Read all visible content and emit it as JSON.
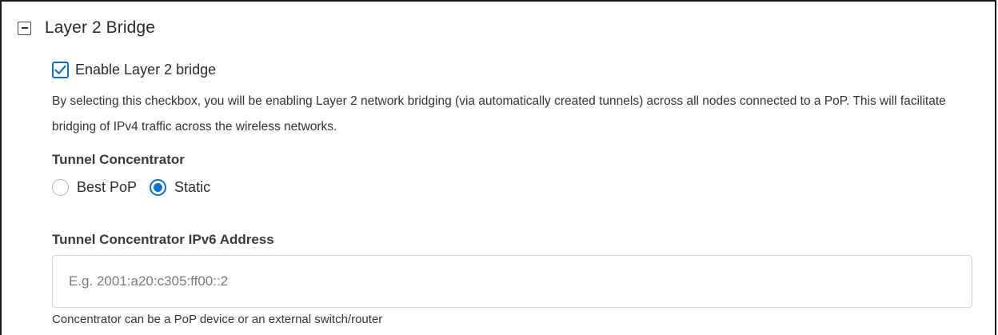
{
  "section": {
    "title": "Layer 2 Bridge",
    "toggle_icon": "collapse-minus-icon"
  },
  "enable_bridge": {
    "label": "Enable Layer 2 bridge",
    "checked": true,
    "description": "By selecting this checkbox, you will be enabling Layer 2 network bridging (via automatically created tunnels) across all nodes connected to a PoP. This will facilitate bridging of IPv4 traffic across the wireless networks."
  },
  "tunnel_concentrator": {
    "label": "Tunnel Concentrator",
    "options": [
      {
        "label": "Best PoP",
        "selected": false
      },
      {
        "label": "Static",
        "selected": true
      }
    ]
  },
  "ipv6_address": {
    "label": "Tunnel Concentrator IPv6 Address",
    "value": "",
    "placeholder": "E.g. 2001:a20:c305:ff00::2",
    "hint": "Concentrator can be a PoP device or an external switch/router"
  },
  "colors": {
    "accent": "#0a6ed1",
    "text": "#2b2b2b",
    "input_border": "#cfd4d9"
  }
}
